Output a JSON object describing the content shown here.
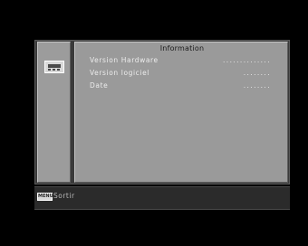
{
  "panel": {
    "title": "Information",
    "rows": [
      {
        "label": "Version Hardware",
        "value": ".............."
      },
      {
        "label": "Version logiciel",
        "value": "........"
      },
      {
        "label": "Date",
        "value": "........"
      }
    ]
  },
  "side": {
    "icon": "set-top-box-icon"
  },
  "footer": {
    "key_label": "MENU",
    "action_label": "Sortir"
  }
}
